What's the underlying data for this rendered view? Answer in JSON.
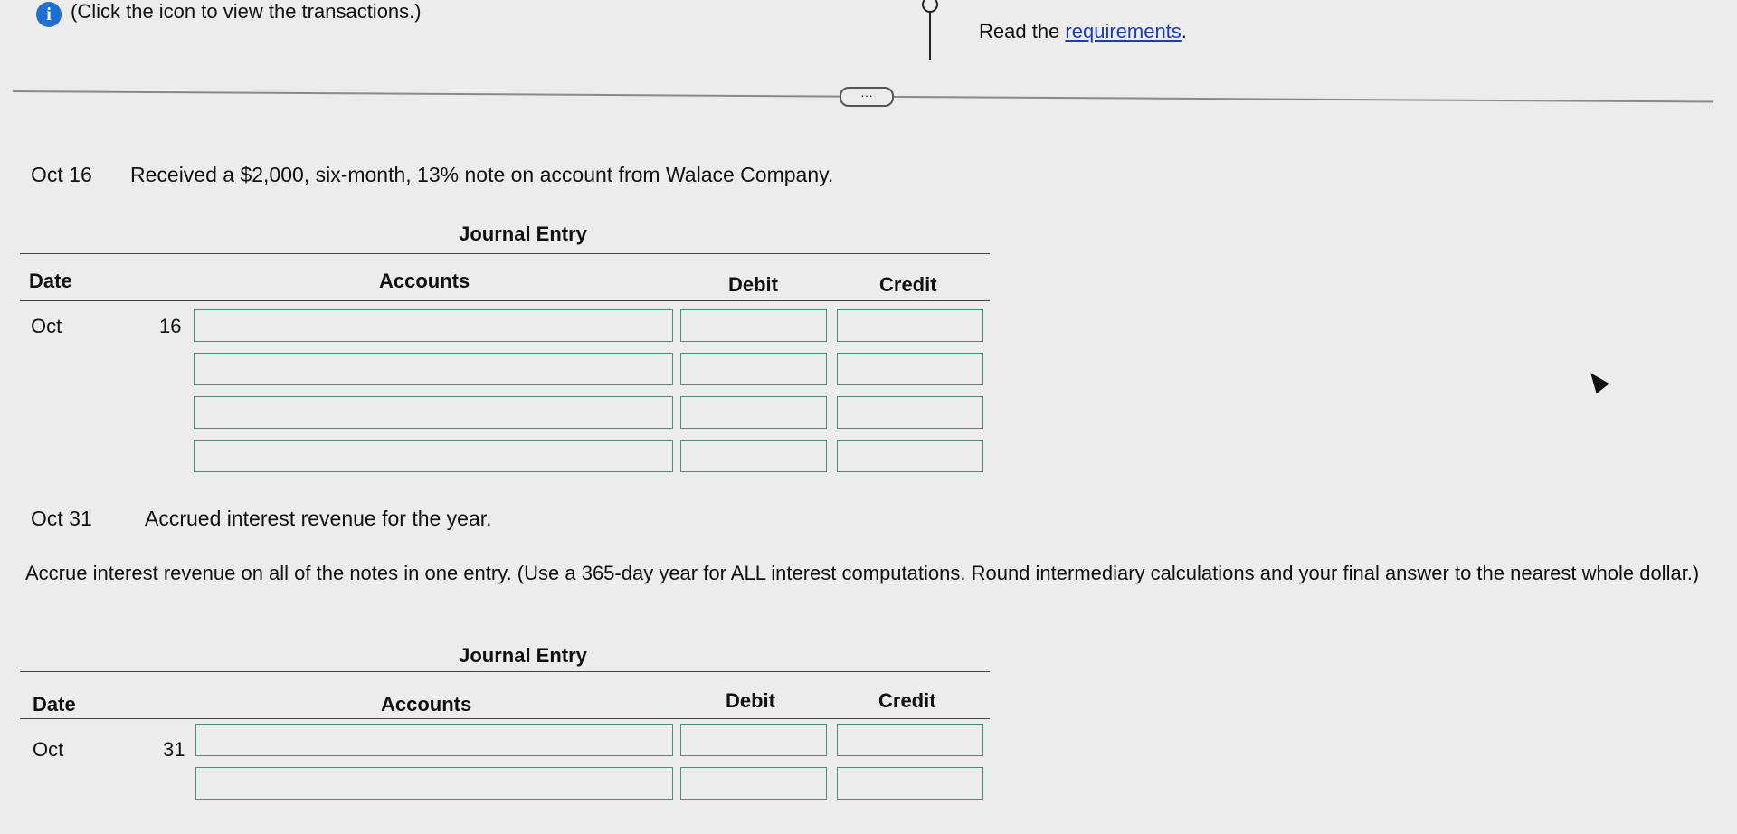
{
  "header": {
    "instruction": "(Click the icon to view the transactions.)",
    "requirements_prefix": "Read the ",
    "requirements_link": "requirements",
    "requirements_suffix": ".",
    "more_button": "···"
  },
  "transaction1": {
    "date": "Oct 16",
    "description": "Received a $2,000, six-month, 13% note on account from Walace Company."
  },
  "journal1": {
    "title": "Journal Entry",
    "col_date": "Date",
    "col_accounts": "Accounts",
    "col_debit": "Debit",
    "col_credit": "Credit",
    "month": "Oct",
    "day": "16",
    "rows": [
      {
        "account": "",
        "debit": "",
        "credit": ""
      },
      {
        "account": "",
        "debit": "",
        "credit": ""
      },
      {
        "account": "",
        "debit": "",
        "credit": ""
      },
      {
        "account": "",
        "debit": "",
        "credit": ""
      }
    ]
  },
  "transaction2": {
    "date": "Oct 31",
    "description": "Accrued interest revenue for the year."
  },
  "instructions2": "Accrue interest revenue on all of the notes in one entry. (Use a 365-day year for ALL interest computations. Round intermediary calculations and your final answer to the nearest whole dollar.)",
  "journal2": {
    "title": "Journal Entry",
    "col_date": "Date",
    "col_accounts": "Accounts",
    "col_debit": "Debit",
    "col_credit": "Credit",
    "month": "Oct",
    "day": "31",
    "rows": [
      {
        "account": "",
        "debit": "",
        "credit": ""
      },
      {
        "account": "",
        "debit": "",
        "credit": ""
      }
    ]
  },
  "colors": {
    "input_border": "#4b8f75",
    "link": "#1a3fb5",
    "info_icon": "#1e6fd0"
  }
}
